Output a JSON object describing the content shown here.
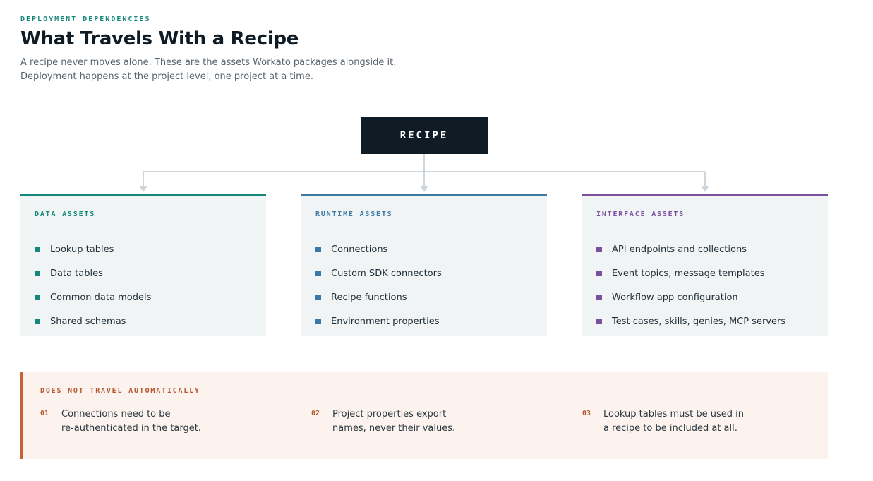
{
  "header": {
    "eyebrow": "DEPLOYMENT DEPENDENCIES",
    "title": "What Travels With a Recipe",
    "subtitle_line1": "A recipe never moves alone. These are the assets Workato packages alongside it.",
    "subtitle_line2": "Deployment happens at the project level, one project at a time."
  },
  "root": {
    "label": "RECIPE"
  },
  "cards": [
    {
      "heading": "DATA ASSETS",
      "color": "#15877a",
      "items": [
        "Lookup tables",
        "Data tables",
        "Common data models",
        "Shared schemas"
      ]
    },
    {
      "heading": "RUNTIME ASSETS",
      "color": "#3b79a4",
      "items": [
        "Connections",
        "Custom SDK connectors",
        "Recipe functions",
        "Environment properties"
      ]
    },
    {
      "heading": "INTERFACE ASSETS",
      "color": "#7a4fa0",
      "items": [
        "API endpoints and collections",
        "Event topics, message templates",
        "Workflow app configuration",
        "Test cases, skills, genies, MCP servers"
      ]
    }
  ],
  "notice": {
    "heading": "DOES NOT TRAVEL AUTOMATICALLY",
    "color": "#c4603a",
    "items": [
      {
        "num": "01",
        "line1": "Connections need to be",
        "line2": "re-authenticated in the target."
      },
      {
        "num": "02",
        "line1": "Project properties export",
        "line2": "names, never their values."
      },
      {
        "num": "03",
        "line1": "Lookup tables must be used in",
        "line2": "a recipe to be included at all."
      }
    ]
  }
}
